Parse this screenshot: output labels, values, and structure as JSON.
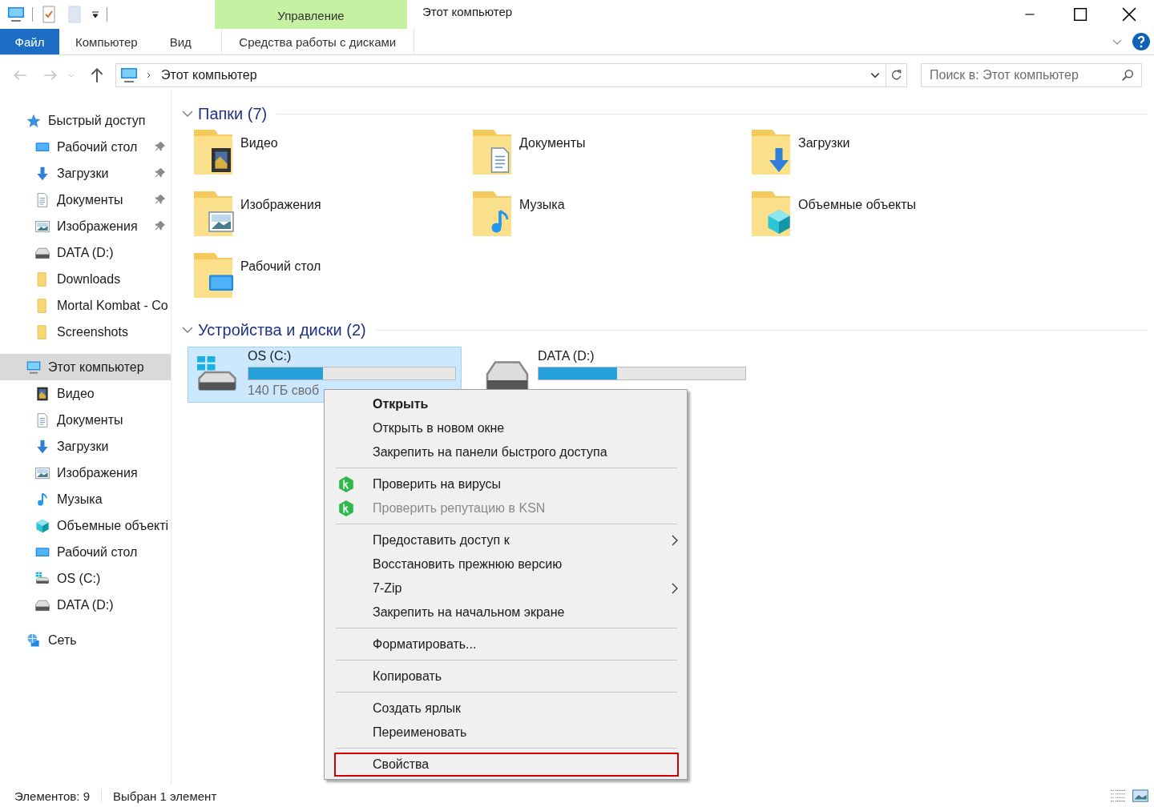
{
  "window": {
    "title": "Этот компьютер",
    "context_group": "Управление"
  },
  "ribbon_tabs": [
    {
      "label": "Файл",
      "kind": "file"
    },
    {
      "label": "Компьютер",
      "kind": "tab"
    },
    {
      "label": "Вид",
      "kind": "tab"
    },
    {
      "label": "Средства работы с дисками",
      "kind": "context"
    }
  ],
  "address": {
    "path": "Этот компьютер"
  },
  "search": {
    "placeholder": "Поиск в: Этот компьютер"
  },
  "sidebar": {
    "items": [
      {
        "label": "Быстрый доступ",
        "kind": "star",
        "selected": false,
        "children": [
          {
            "label": "Рабочий стол",
            "kind": "desktop",
            "selected": false,
            "pinned": true
          },
          {
            "label": "Загрузки",
            "kind": "download",
            "selected": false,
            "pinned": true
          },
          {
            "label": "Документы",
            "kind": "document",
            "selected": false,
            "pinned": true
          },
          {
            "label": "Изображения",
            "kind": "pictures",
            "selected": false,
            "pinned": true
          },
          {
            "label": "DATA (D:)",
            "kind": "drive",
            "selected": false,
            "pinned": false
          },
          {
            "label": "Downloads",
            "kind": "folder",
            "selected": false,
            "pinned": false
          },
          {
            "label": "Mortal Kombat - Co",
            "kind": "folder",
            "selected": false,
            "pinned": false
          },
          {
            "label": "Screenshots",
            "kind": "folder",
            "selected": false,
            "pinned": false
          }
        ]
      },
      {
        "label": "Этот компьютер",
        "kind": "computer",
        "selected": true,
        "children": [
          {
            "label": "Видео",
            "kind": "video",
            "selected": false,
            "pinned": false
          },
          {
            "label": "Документы",
            "kind": "document",
            "selected": false,
            "pinned": false
          },
          {
            "label": "Загрузки",
            "kind": "download",
            "selected": false,
            "pinned": false
          },
          {
            "label": "Изображения",
            "kind": "pictures",
            "selected": false,
            "pinned": false
          },
          {
            "label": "Музыка",
            "kind": "music",
            "selected": false,
            "pinned": false
          },
          {
            "label": "Объемные объекті",
            "kind": "objects",
            "selected": false,
            "pinned": false
          },
          {
            "label": "Рабочий стол",
            "kind": "desktop",
            "selected": false,
            "pinned": false
          },
          {
            "label": "OS (C:)",
            "kind": "osdrive",
            "selected": false,
            "pinned": false
          },
          {
            "label": "DATA (D:)",
            "kind": "drive",
            "selected": false,
            "pinned": false
          }
        ]
      },
      {
        "label": "Сеть",
        "kind": "network",
        "selected": false
      }
    ]
  },
  "folders": {
    "title": "Папки (7)",
    "items": [
      {
        "label": "Видео",
        "kind": "video"
      },
      {
        "label": "Документы",
        "kind": "document"
      },
      {
        "label": "Загрузки",
        "kind": "download"
      },
      {
        "label": "Изображения",
        "kind": "pictures"
      },
      {
        "label": "Музыка",
        "kind": "music"
      },
      {
        "label": "Объемные объекты",
        "kind": "objects"
      },
      {
        "label": "Рабочий стол",
        "kind": "desktop"
      }
    ]
  },
  "drives": {
    "title": "Устройства и диски (2)",
    "items": [
      {
        "label": "OS (C:)",
        "kind": "osdrive",
        "selected": true,
        "level": 0.36,
        "free": "140 ГБ своб"
      },
      {
        "label": "DATA (D:)",
        "kind": "drive",
        "selected": false,
        "level": 0.38
      }
    ]
  },
  "context_menu": {
    "groups": [
      [
        {
          "label": "Открыть",
          "default": true,
          "disabled": false,
          "submenu": false,
          "highlighted": false
        },
        {
          "label": "Открыть в новом окне",
          "default": false,
          "disabled": false,
          "submenu": false,
          "highlighted": false
        },
        {
          "label": "Закрепить на панели быстрого доступа",
          "default": false,
          "disabled": false,
          "submenu": false,
          "highlighted": false
        }
      ],
      [
        {
          "label": "Проверить на вирусы",
          "default": false,
          "disabled": false,
          "submenu": false,
          "highlighted": false,
          "kind": "shield"
        },
        {
          "label": "Проверить репутацию в KSN",
          "default": false,
          "disabled": true,
          "submenu": false,
          "highlighted": false,
          "kind": "shield"
        }
      ],
      [
        {
          "label": "Предоставить доступ к",
          "default": false,
          "disabled": false,
          "submenu": true,
          "highlighted": false
        },
        {
          "label": "Восстановить прежнюю версию",
          "default": false,
          "disabled": false,
          "submenu": false,
          "highlighted": false
        },
        {
          "label": "7-Zip",
          "default": false,
          "disabled": false,
          "submenu": true,
          "highlighted": false
        },
        {
          "label": "Закрепить на начальном экране",
          "default": false,
          "disabled": false,
          "submenu": false,
          "highlighted": false
        }
      ],
      [
        {
          "label": "Форматировать...",
          "default": false,
          "disabled": false,
          "submenu": false,
          "highlighted": false
        }
      ],
      [
        {
          "label": "Копировать",
          "default": false,
          "disabled": false,
          "submenu": false,
          "highlighted": false
        }
      ],
      [
        {
          "label": "Создать ярлык",
          "default": false,
          "disabled": false,
          "submenu": false,
          "highlighted": false
        },
        {
          "label": "Переименовать",
          "default": false,
          "disabled": false,
          "submenu": false,
          "highlighted": false
        }
      ],
      [
        {
          "label": "Свойства",
          "default": false,
          "disabled": false,
          "submenu": false,
          "highlighted": true
        }
      ]
    ]
  },
  "status_bar": {
    "count": "Элементов: 9",
    "selection": "Выбран 1 элемент"
  }
}
